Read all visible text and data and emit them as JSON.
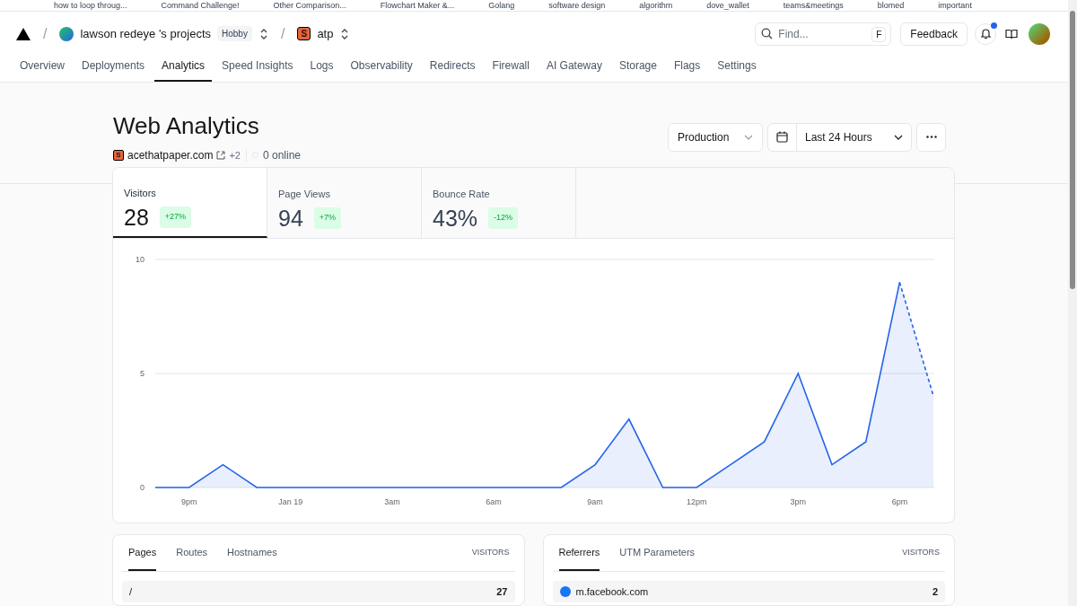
{
  "bookmarks": [
    "how to loop throug...",
    "Command Challenge!",
    "Other Comparison...",
    "Flowchart Maker &...",
    "Golang",
    "software design",
    "algorithm",
    "dove_wallet",
    "teams&meetings",
    "blomed",
    "important"
  ],
  "breadcrumb": {
    "separator": "/",
    "team": "lawson redeye 's projects",
    "plan": "Hobby",
    "project_initial": "S",
    "project": "atp"
  },
  "search": {
    "placeholder": "Find...",
    "shortcut": "F"
  },
  "feedback": "Feedback",
  "notifications": {
    "unread": true
  },
  "tabs": [
    {
      "label": "Overview",
      "selected": false
    },
    {
      "label": "Deployments",
      "selected": false
    },
    {
      "label": "Analytics",
      "selected": true
    },
    {
      "label": "Speed Insights",
      "selected": false
    },
    {
      "label": "Logs",
      "selected": false
    },
    {
      "label": "Observability",
      "selected": false
    },
    {
      "label": "Redirects",
      "selected": false
    },
    {
      "label": "Firewall",
      "selected": false
    },
    {
      "label": "AI Gateway",
      "selected": false
    },
    {
      "label": "Storage",
      "selected": false
    },
    {
      "label": "Flags",
      "selected": false
    },
    {
      "label": "Settings",
      "selected": false
    }
  ],
  "page": {
    "title": "Web Analytics",
    "site_initial": "S",
    "domain": "acethatpaper.com",
    "extra": "+2",
    "online": "0 online"
  },
  "filters": {
    "environment": "Production",
    "range": "Last 24 Hours"
  },
  "metrics": [
    {
      "label": "Visitors",
      "value": "28",
      "change": "+27%",
      "selected": true
    },
    {
      "label": "Page Views",
      "value": "94",
      "change": "+7%",
      "selected": false
    },
    {
      "label": "Bounce Rate",
      "value": "43%",
      "change": "-12%",
      "selected": false
    }
  ],
  "chart_data": {
    "type": "area",
    "categories": [
      null,
      "9pm",
      null,
      null,
      "Jan 19",
      null,
      null,
      "3am",
      null,
      null,
      "6am",
      null,
      null,
      "9am",
      null,
      null,
      "12pm",
      null,
      null,
      "3pm",
      null,
      null,
      "6pm",
      null
    ],
    "ylim": [
      0,
      10
    ],
    "yticks": [
      0,
      5,
      10
    ],
    "series": [
      {
        "color": "#2563eb",
        "values": [
          0,
          0,
          1,
          0,
          0,
          0,
          0,
          0,
          0,
          0,
          0,
          0,
          0,
          1,
          3,
          0,
          0,
          1,
          2,
          5,
          1,
          2,
          9,
          4
        ]
      }
    ]
  },
  "panels": [
    {
      "tabs": [
        {
          "label": "Pages",
          "selected": true
        },
        {
          "label": "Routes",
          "selected": false
        },
        {
          "label": "Hostnames",
          "selected": false
        }
      ],
      "column": "VISITORS",
      "rows": [
        {
          "label": "/",
          "value": "27",
          "kind": "page"
        }
      ]
    },
    {
      "tabs": [
        {
          "label": "Referrers",
          "selected": true
        },
        {
          "label": "UTM Parameters",
          "selected": false
        }
      ],
      "column": "VISITORS",
      "rows": [
        {
          "label": "m.facebook.com",
          "value": "2",
          "kind": "referrer"
        }
      ]
    }
  ]
}
